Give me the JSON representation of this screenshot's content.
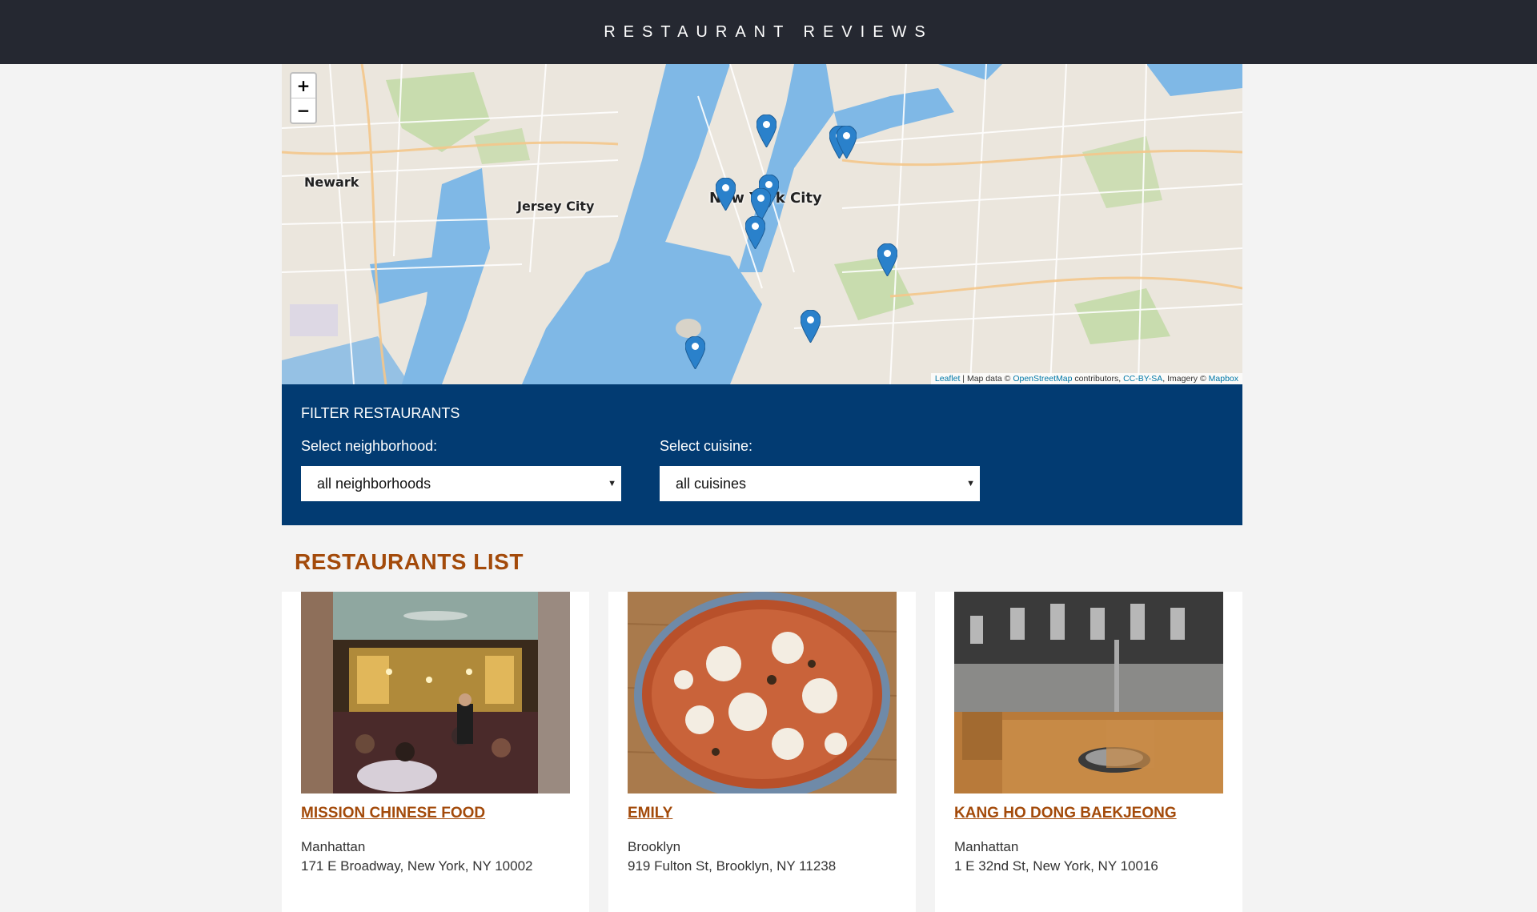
{
  "header": {
    "title": "RESTAURANT REVIEWS"
  },
  "map": {
    "zoom_in": "+",
    "zoom_out": "−",
    "labels": [
      "Newark",
      "Jersey City",
      "New York City"
    ],
    "attribution": {
      "leaflet": "Leaflet",
      "sep": " | Map data © ",
      "osm": "OpenStreetMap",
      "contributors": " contributors, ",
      "license": "CC-BY-SA",
      "imagery": ", Imagery © ",
      "mapbox": "Mapbox"
    },
    "marker_color": "#2a81cb",
    "water_color": "#7fb8e6"
  },
  "filter": {
    "title": "FILTER RESTAURANTS",
    "neighborhood_label": "Select neighborhood:",
    "neighborhood_value": "all neighborhoods",
    "cuisine_label": "Select cuisine:",
    "cuisine_value": "all cuisines"
  },
  "list": {
    "title": "RESTAURANTS LIST",
    "restaurants": [
      {
        "name": "MISSION CHINESE FOOD",
        "neighborhood": "Manhattan",
        "address": "171 E Broadway, New York, NY 10002"
      },
      {
        "name": "EMILY",
        "neighborhood": "Brooklyn",
        "address": "919 Fulton St, Brooklyn, NY 11238"
      },
      {
        "name": "KANG HO DONG BAEKJEONG",
        "neighborhood": "Manhattan",
        "address": "1 E 32nd St, New York, NY 10016"
      }
    ]
  },
  "colors": {
    "header_bg": "#252831",
    "filter_bg": "#023b72",
    "accent": "#a34a0a"
  }
}
